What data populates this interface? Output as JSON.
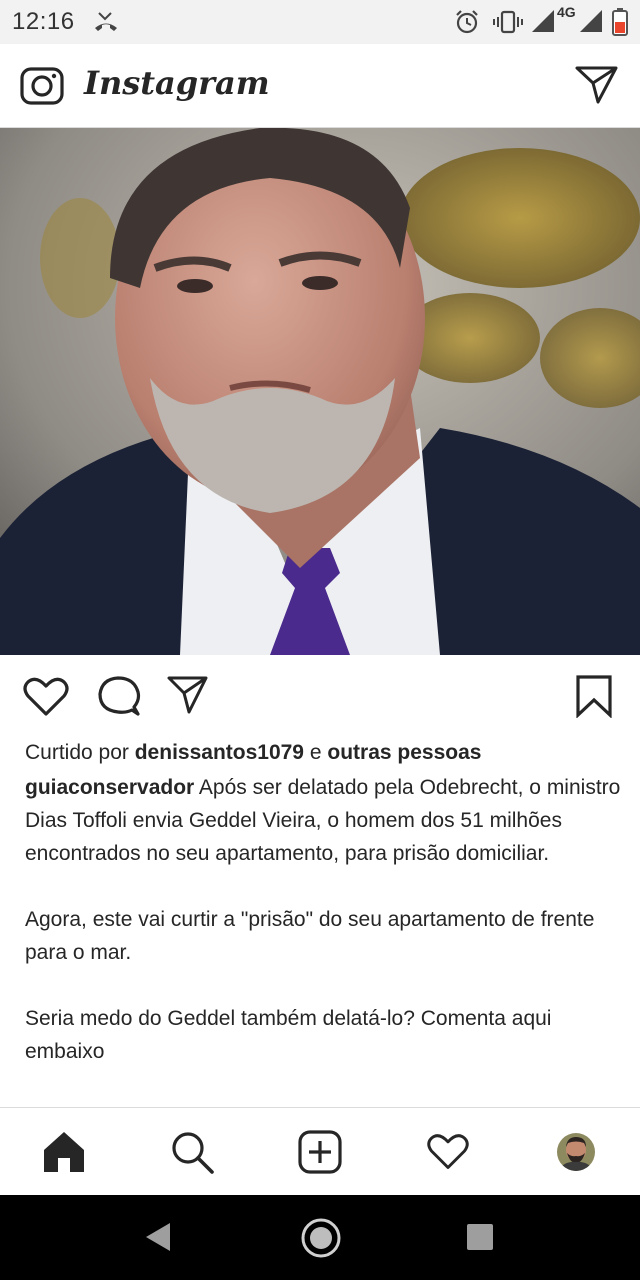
{
  "status_bar": {
    "time": "12:16",
    "network": "4G",
    "icons": [
      "missed-call-icon",
      "alarm-icon",
      "vibrate-icon",
      "signal-icon",
      "signal-icon",
      "battery-icon"
    ]
  },
  "header": {
    "app_name": "Instagram",
    "icons": [
      "camera-icon",
      "direct-message-icon"
    ]
  },
  "post": {
    "image_subject": "portrait of a man in dark suit and purple tie",
    "actions": [
      "heart-icon",
      "comment-icon",
      "share-icon",
      "bookmark-icon"
    ],
    "liked_by_prefix": "Curtido por",
    "liked_by_user": "denissantos1079",
    "liked_by_connector": "e",
    "liked_by_others": "outras pessoas",
    "caption_user": "guiaconservador",
    "caption_line1": "Após ser delatado pela Odebrecht, o ministro Dias Toffoli envia Geddel Vieira, o homem dos 51 milhões encontrados no seu apartamento, para prisão domiciliar.",
    "caption_para2": "Agora, este vai curtir a \"prisão\" do seu apartamento de frente para o mar.",
    "caption_para3": "Seria medo do Geddel também delatá-lo? Comenta aqui embaixo"
  },
  "bottom_nav": {
    "items": [
      "home-icon",
      "search-icon",
      "new-post-icon",
      "activity-icon",
      "profile-avatar"
    ]
  },
  "system_nav": {
    "items": [
      "back-icon",
      "home-circle-icon",
      "recents-icon"
    ]
  },
  "colors": {
    "text": "#262626",
    "status_bar_bg": "#f2f2f2",
    "tie": "#4a2a8c",
    "suit": "#1c2236",
    "battery": "#e8452c"
  }
}
